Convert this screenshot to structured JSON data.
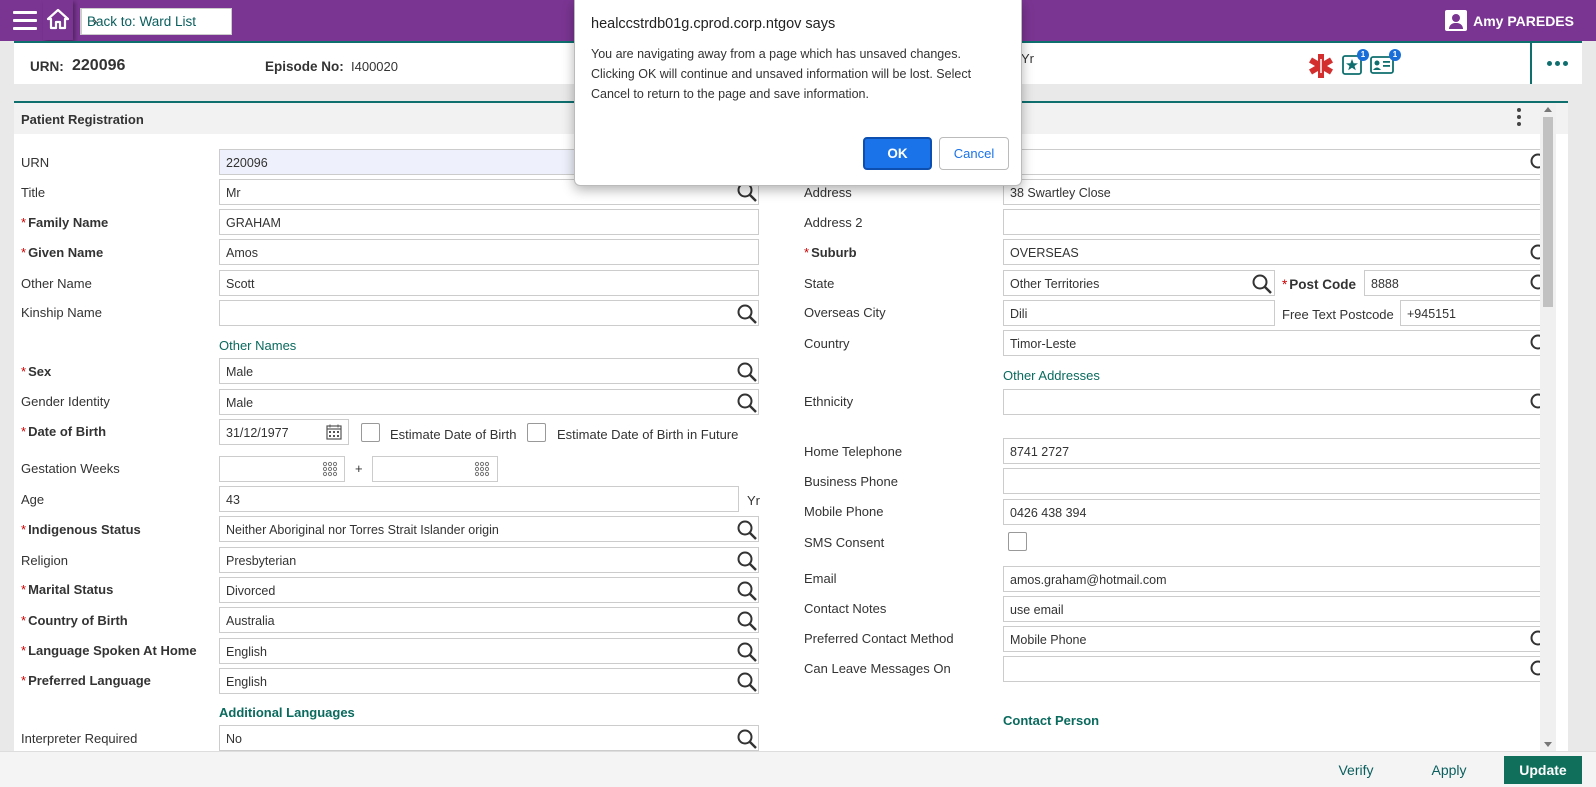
{
  "topbar": {
    "back_label": "Back to: Ward List",
    "user_name": "Amy PAREDES",
    "accent_color": "#7a3592"
  },
  "header": {
    "urn_label": "URN:",
    "urn_value": "220096",
    "episode_label": "Episode No:",
    "episode_value": "I400020",
    "age_suffix": "Yr",
    "badge_star": "1",
    "badge_card": "1"
  },
  "panel": {
    "title": "Patient Registration"
  },
  "left_fields": {
    "urn": {
      "label": "URN",
      "value": "220096"
    },
    "title": {
      "label": "Title",
      "value": "Mr"
    },
    "family_name": {
      "label": "Family Name",
      "value": "GRAHAM"
    },
    "given_name": {
      "label": "Given Name",
      "value": "Amos"
    },
    "other_name": {
      "label": "Other Name",
      "value": "Scott"
    },
    "kinship_name": {
      "label": "Kinship Name",
      "value": ""
    },
    "other_names_link": "Other Names",
    "sex": {
      "label": "Sex",
      "value": "Male"
    },
    "gender_identity": {
      "label": "Gender Identity",
      "value": "Male"
    },
    "dob": {
      "label": "Date of Birth",
      "value": "31/12/1977"
    },
    "estimate_dob": "Estimate Date of Birth",
    "estimate_dob_future": "Estimate Date of Birth in Future",
    "gestation_weeks": {
      "label": "Gestation Weeks",
      "value": ""
    },
    "gestation_plus": "+",
    "age": {
      "label": "Age",
      "value": "43",
      "unit": "Yr"
    },
    "indigenous_status": {
      "label": "Indigenous Status",
      "value": "Neither Aboriginal nor Torres Strait Islander origin"
    },
    "religion": {
      "label": "Religion",
      "value": "Presbyterian"
    },
    "marital_status": {
      "label": "Marital Status",
      "value": "Divorced"
    },
    "country_of_birth": {
      "label": "Country of Birth",
      "value": "Australia"
    },
    "language_home": {
      "label": "Language Spoken At Home",
      "value": "English"
    },
    "preferred_language": {
      "label": "Preferred Language",
      "value": "English"
    },
    "additional_languages_link": "Additional Languages",
    "interpreter_required": {
      "label": "Interpreter Required",
      "value": "No"
    }
  },
  "right_fields": {
    "address_search": {
      "value": ""
    },
    "address": {
      "label": "Address",
      "value": "38 Swartley Close"
    },
    "address2": {
      "label": "Address 2",
      "value": ""
    },
    "suburb": {
      "label": "Suburb",
      "value": "OVERSEAS"
    },
    "state": {
      "label": "State",
      "value": "Other Territories"
    },
    "post_code": {
      "label": "Post Code",
      "value": "8888"
    },
    "overseas_city": {
      "label": "Overseas City",
      "value": "Dili"
    },
    "free_text_postcode": {
      "label": "Free Text Postcode",
      "value": "+945151"
    },
    "country": {
      "label": "Country",
      "value": "Timor-Leste"
    },
    "other_addresses_link": "Other Addresses",
    "ethnicity": {
      "label": "Ethnicity",
      "value": ""
    },
    "home_telephone": {
      "label": "Home Telephone",
      "value": "8741 2727"
    },
    "business_phone": {
      "label": "Business Phone",
      "value": ""
    },
    "mobile_phone": {
      "label": "Mobile Phone",
      "value": "0426 438 394"
    },
    "sms_consent": {
      "label": "SMS Consent"
    },
    "email": {
      "label": "Email",
      "value": "amos.graham@hotmail.com"
    },
    "contact_notes": {
      "label": "Contact Notes",
      "value": "use email"
    },
    "preferred_contact": {
      "label": "Preferred Contact Method",
      "value": "Mobile Phone"
    },
    "can_leave_messages": {
      "label": "Can Leave Messages On",
      "value": ""
    },
    "contact_person_link": "Contact Person"
  },
  "footer": {
    "verify": "Verify",
    "apply": "Apply",
    "update": "Update"
  },
  "dialog": {
    "title": "healccstrdb01g.cprod.corp.ntgov says",
    "message": "You are navigating away from a page which has unsaved changes. Clicking OK will continue and unsaved information will be lost. Select Cancel to return to the page and save information.",
    "ok": "OK",
    "cancel": "Cancel"
  }
}
